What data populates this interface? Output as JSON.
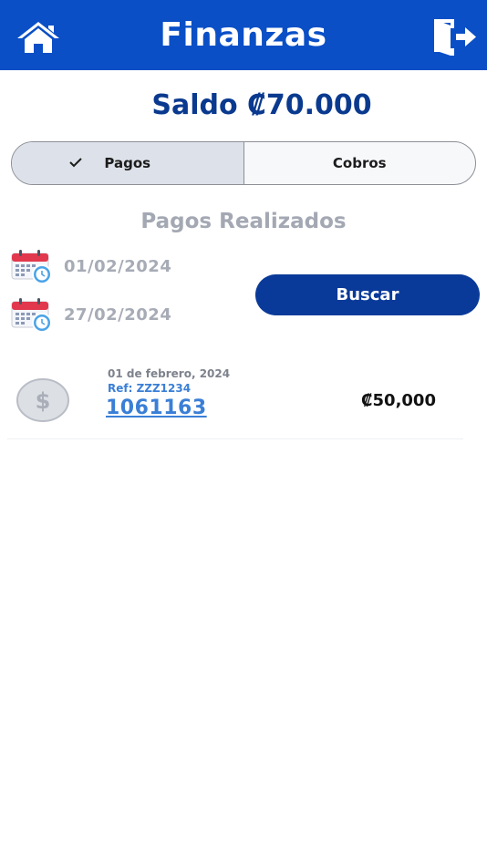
{
  "header": {
    "title": "Finanzas",
    "home_icon": "home-icon",
    "exit_icon": "logout-icon",
    "color": "#0a4fc6"
  },
  "balance": {
    "text": "Saldo ₡70.000"
  },
  "tabs": [
    {
      "label": "Pagos",
      "selected": true
    },
    {
      "label": "Cobros",
      "selected": false
    }
  ],
  "section": {
    "title": "Pagos Realizados"
  },
  "filters": {
    "start_date": "01/02/2024",
    "end_date": "27/02/2024",
    "calendar_icon": "calendar-icon",
    "search_label": "Buscar"
  },
  "transactions": [
    {
      "date": "01 de febrero, 2024",
      "ref": "Ref: ZZZ1234",
      "number": "1061163",
      "amount": "₡50,000",
      "icon": "dollar-coin-icon"
    }
  ]
}
